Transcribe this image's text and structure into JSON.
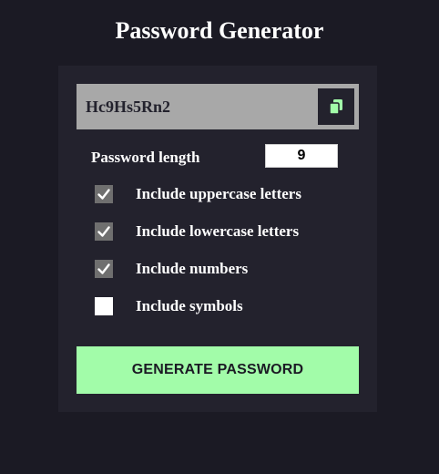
{
  "app": {
    "title": "Password Generator"
  },
  "result": {
    "password": "Hc9Hs5Rn2",
    "copy_icon": "copy-icon"
  },
  "length": {
    "label": "Password length",
    "value": "9"
  },
  "options": [
    {
      "label": "Include uppercase letters",
      "checked": true
    },
    {
      "label": "Include lowercase letters",
      "checked": true
    },
    {
      "label": "Include numbers",
      "checked": true
    },
    {
      "label": "Include symbols",
      "checked": false
    }
  ],
  "generate": {
    "label": "GENERATE PASSWORD"
  },
  "colors": {
    "background": "#1b1a24",
    "panel": "#23222d",
    "accent": "#a2fca9",
    "result_bg": "#a8a8a8"
  }
}
